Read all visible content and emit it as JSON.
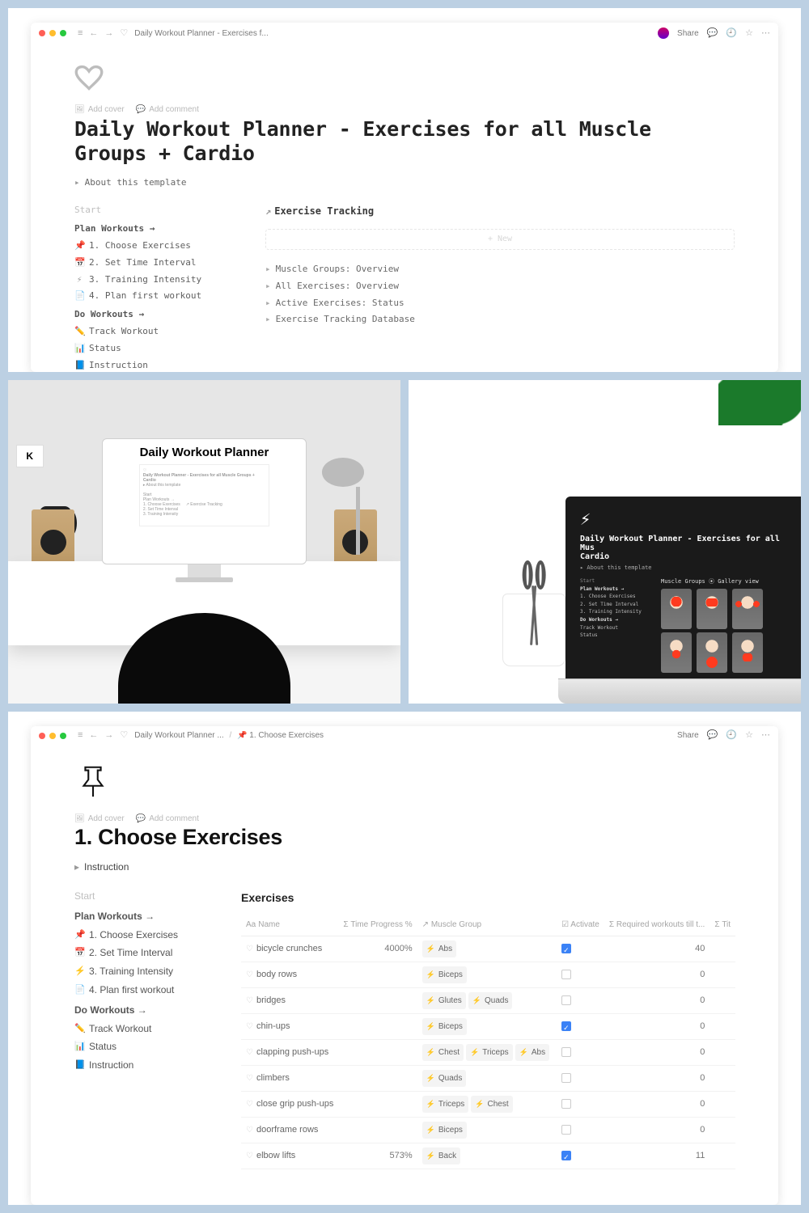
{
  "tile1": {
    "breadcrumb": "Daily Workout Planner - Exercises f...",
    "share": "Share",
    "cover_actions": {
      "add_cover": "Add cover",
      "add_comment": "Add comment"
    },
    "title": "Daily Workout Planner - Exercises for all Muscle Groups + Cardio",
    "about_toggle": "About this template",
    "start_label": "Start",
    "plan_label": "Plan Workouts →",
    "do_label": "Do Workouts →",
    "links": {
      "l1": "1. Choose Exercises",
      "l2": "2. Set Time Interval",
      "l3": "3. Training Intensity",
      "l4": "4. Plan first workout",
      "track": "Track Workout",
      "status": "Status",
      "instr": "Instruction"
    },
    "tracking_head": "Exercise Tracking",
    "ghost": "+ New",
    "bullets": {
      "b1": "Muscle Groups: Overview",
      "b2": "All Exercises: Overview",
      "b3": "Active Exercises: Status",
      "b4": "Exercise Tracking Database"
    }
  },
  "tile2": {
    "headline": "Daily Workout Planner",
    "mini": "Daily Workout Planner - Exercises for all Muscle Groups + Cardio"
  },
  "tile3": {
    "title": "Daily Workout Planner - Exercises for all Mus\nCardio",
    "about": "▸ About this template",
    "start": "Start",
    "plan": "Plan Workouts →",
    "l1": "1. Choose Exercises",
    "l2": "2. Set Time Interval",
    "l3": "3. Training Intensity",
    "do": "Do Workouts →",
    "track": "Track Workout",
    "status": "Status",
    "mg_head": "Muscle Groups ⦿ Gallery view"
  },
  "tile4": {
    "crumb1": "Daily Workout Planner ...",
    "crumb2": "1. Choose Exercises",
    "share": "Share",
    "cover_actions": {
      "add_cover": "Add cover",
      "add_comment": "Add comment"
    },
    "title": "1. Choose Exercises",
    "instr_toggle": "Instruction",
    "start_label": "Start",
    "plan_label": "Plan Workouts →",
    "do_label": "Do Workouts →",
    "links": {
      "l1": "1. Choose Exercises",
      "l2": "2. Set Time Interval",
      "l3": "3. Training Intensity",
      "l4": "4. Plan first workout",
      "track": "Track Workout",
      "status": "Status",
      "instr": "Instruction"
    },
    "table_title": "Exercises",
    "cols": {
      "name": "Name",
      "prog": "Time Progress %",
      "mg": "Muscle Group",
      "act": "Activate",
      "req": "Required workouts till t...",
      "tit": "Tit"
    },
    "rows": [
      {
        "name": "bicycle crunches",
        "prog": "4000%",
        "mg": [
          "Abs"
        ],
        "act": true,
        "req": "40",
        "tit": ""
      },
      {
        "name": "body rows",
        "prog": "",
        "mg": [
          "Biceps"
        ],
        "act": false,
        "req": "0",
        "tit": ""
      },
      {
        "name": "bridges",
        "prog": "",
        "mg": [
          "Glutes",
          "Quads"
        ],
        "act": false,
        "req": "0",
        "tit": ""
      },
      {
        "name": "chin-ups",
        "prog": "",
        "mg": [
          "Biceps"
        ],
        "act": true,
        "req": "0",
        "tit": ""
      },
      {
        "name": "clapping push-ups",
        "prog": "",
        "mg": [
          "Chest",
          "Triceps",
          "Abs"
        ],
        "act": false,
        "req": "0",
        "tit": ""
      },
      {
        "name": "climbers",
        "prog": "",
        "mg": [
          "Quads"
        ],
        "act": false,
        "req": "0",
        "tit": ""
      },
      {
        "name": "close grip push-ups",
        "prog": "",
        "mg": [
          "Triceps",
          "Chest"
        ],
        "act": false,
        "req": "0",
        "tit": ""
      },
      {
        "name": "doorframe rows",
        "prog": "",
        "mg": [
          "Biceps"
        ],
        "act": false,
        "req": "0",
        "tit": ""
      },
      {
        "name": "elbow lifts",
        "prog": "573%",
        "mg": [
          "Back"
        ],
        "act": true,
        "req": "11",
        "tit": ""
      }
    ]
  }
}
